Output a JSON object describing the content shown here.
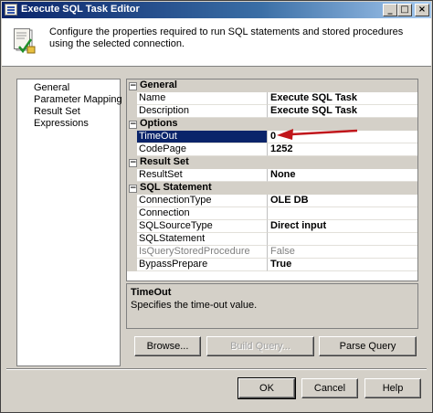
{
  "window": {
    "title": "Execute SQL Task Editor",
    "minimize_glyph": "_",
    "maximize_glyph": "□",
    "close_glyph": "×"
  },
  "header": {
    "text": "Configure the properties required to run SQL statements and stored procedures using the selected connection."
  },
  "nav": {
    "items": [
      "General",
      "Parameter Mapping",
      "Result Set",
      "Expressions"
    ]
  },
  "grid": {
    "categories": {
      "general": "General",
      "options": "Options",
      "result_set": "Result Set",
      "sql_statement": "SQL Statement"
    },
    "toggle_glyph": "−",
    "rows": {
      "name": {
        "name": "Name",
        "value": "Execute SQL Task"
      },
      "description": {
        "name": "Description",
        "value": "Execute SQL Task"
      },
      "timeout": {
        "name": "TimeOut",
        "value": "0"
      },
      "codepage": {
        "name": "CodePage",
        "value": "1252"
      },
      "resultset": {
        "name": "ResultSet",
        "value": "None"
      },
      "connectiontype": {
        "name": "ConnectionType",
        "value": "OLE DB"
      },
      "connection": {
        "name": "Connection",
        "value": ""
      },
      "sqlsourcetype": {
        "name": "SQLSourceType",
        "value": "Direct input"
      },
      "sqlstatement": {
        "name": "SQLStatement",
        "value": ""
      },
      "isquerystoredprocedure": {
        "name": "IsQueryStoredProcedure",
        "value": "False"
      },
      "bypassprepare": {
        "name": "BypassPrepare",
        "value": "True"
      }
    },
    "selected_row": "TimeOut"
  },
  "description_pane": {
    "title": "TimeOut",
    "text": "Specifies the time-out value."
  },
  "buttons": {
    "browse": "Browse...",
    "build_query": "Build Query...",
    "parse_query": "Parse Query",
    "ok": "OK",
    "cancel": "Cancel",
    "help": "Help"
  },
  "colors": {
    "title_bar": "#0a246a",
    "selection": "#0a246a",
    "annotation_arrow": "#c0161b",
    "face": "#d4d0c8"
  },
  "icons": [
    "app-icon",
    "task-editor-icon",
    "annotation-arrow"
  ]
}
